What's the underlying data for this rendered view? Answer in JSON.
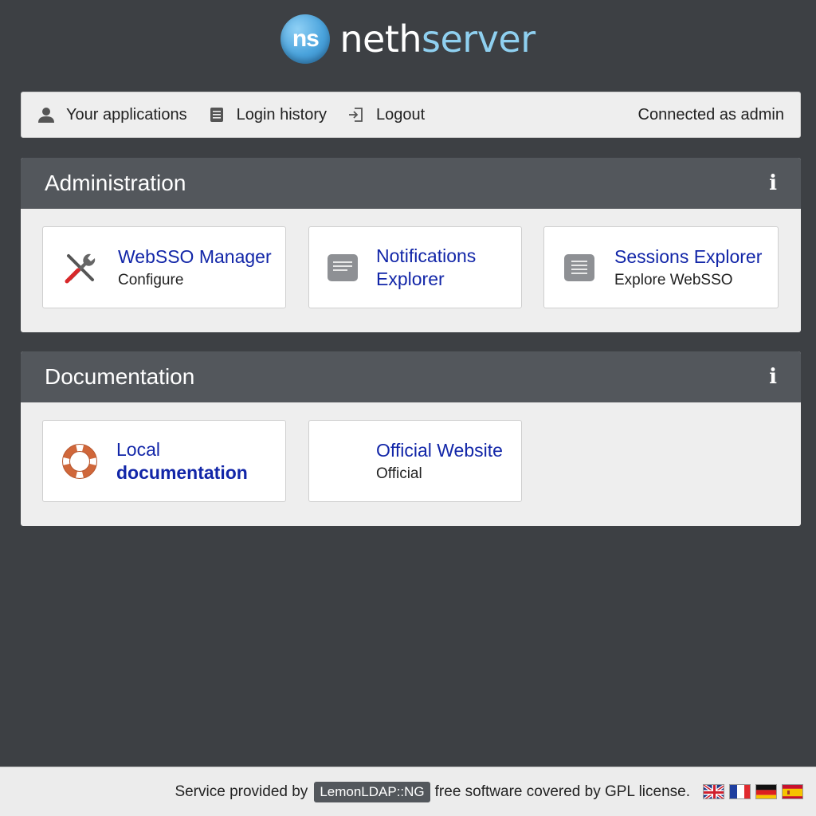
{
  "logo": {
    "badge": "ns",
    "name_white": "neth",
    "name_blue": "server"
  },
  "navbar": {
    "items": [
      {
        "label": "Your applications",
        "icon": "user-icon"
      },
      {
        "label": "Login history",
        "icon": "document-icon"
      },
      {
        "label": "Logout",
        "icon": "logout-icon"
      }
    ],
    "connected": "Connected as admin"
  },
  "sections": [
    {
      "title": "Administration",
      "info": "i",
      "apps": [
        {
          "title": "WebSSO Manager",
          "title2": "",
          "desc": "Configure",
          "icon": "tools-icon"
        },
        {
          "title": "Notifications",
          "title2": "Explorer",
          "desc": "",
          "icon": "notes-icon"
        },
        {
          "title": "Sessions Explorer",
          "title2": "",
          "desc": "Explore WebSSO",
          "icon": "list-icon"
        }
      ]
    },
    {
      "title": "Documentation",
      "info": "i",
      "apps": [
        {
          "title": "Local",
          "title2": "documentation",
          "desc": "",
          "icon": "lifebuoy-icon"
        },
        {
          "title": "Official Website",
          "title2": "",
          "desc": "Official",
          "icon": ""
        }
      ]
    }
  ],
  "footer": {
    "prefix": "Service provided by",
    "badge": "LemonLDAP::NG",
    "suffix": "free software covered by GPL license.",
    "languages": [
      "en-flag-icon",
      "fr-flag-icon",
      "de-flag-icon",
      "es-flag-icon"
    ]
  },
  "colors": {
    "background": "#3d4044",
    "panel_header": "#53575c",
    "link": "#1226a8",
    "logo_blue": "#8fd0f0"
  }
}
